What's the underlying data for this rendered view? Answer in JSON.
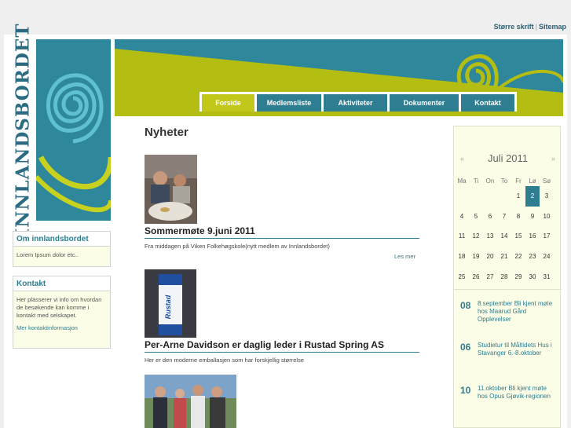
{
  "util_links": {
    "larger_font": "Større skrift",
    "separator": "|",
    "sitemap": "Sitemap"
  },
  "logo": {
    "wordmark": "INNLANDSBORDET"
  },
  "nav": [
    {
      "label": "Forside"
    },
    {
      "label": "Medlemsliste"
    },
    {
      "label": "Aktiviteter"
    },
    {
      "label": "Dokumenter"
    },
    {
      "label": "Kontakt"
    }
  ],
  "sidebar": {
    "about": {
      "title": "Om innlandsbordet",
      "body": "Lorem Ipsum dolor etc.."
    },
    "contact": {
      "title": "Kontakt",
      "body": "Her plasserer vi info om hvordan de besøkende kan komme i kontakt med selskapet.",
      "link": "Mer kontaktinformasjon"
    }
  },
  "main": {
    "heading": "Nyheter",
    "posts": [
      {
        "title": "Sommermøte 9.juni 2011",
        "excerpt": "Fra middagen på Viken Folkehøgskole(nytt medlem av Innlandsbordet)",
        "more": "Les mer"
      },
      {
        "title": "Per-Arne Davidson er daglig leder i Rustad Spring AS",
        "excerpt": "Her er den moderne emballasjen som har forskjellig størrelse",
        "carton_text": "Rustad"
      },
      {
        "title": "",
        "excerpt": ""
      }
    ]
  },
  "calendar": {
    "month": "Juli 2011",
    "prev": "«",
    "next": "»",
    "weekdays": [
      "Ma",
      "Ti",
      "On",
      "To",
      "Fr",
      "Lø",
      "Sø"
    ],
    "weeks": [
      [
        "",
        "",
        "",
        "",
        "1",
        "2",
        "3"
      ],
      [
        "4",
        "5",
        "6",
        "7",
        "8",
        "9",
        "10"
      ],
      [
        "11",
        "12",
        "13",
        "14",
        "15",
        "16",
        "17"
      ],
      [
        "18",
        "19",
        "20",
        "21",
        "22",
        "23",
        "24"
      ],
      [
        "25",
        "26",
        "27",
        "28",
        "29",
        "30",
        "31"
      ]
    ],
    "today": "2",
    "events": [
      {
        "day": "08",
        "text": "8.september Bli kjent møte hos Maarud Gård Opplevelser"
      },
      {
        "day": "06",
        "text": "Studietur til Måltidets Hus i Stavanger 6.-8.oktober"
      },
      {
        "day": "10",
        "text": "11.oktober Bli kjent møte hos Opus Gjøvik-regionen"
      }
    ]
  },
  "colors": {
    "teal": "#2e7d91",
    "lime": "#b3bd12",
    "active_tab": "#c2c81a"
  }
}
